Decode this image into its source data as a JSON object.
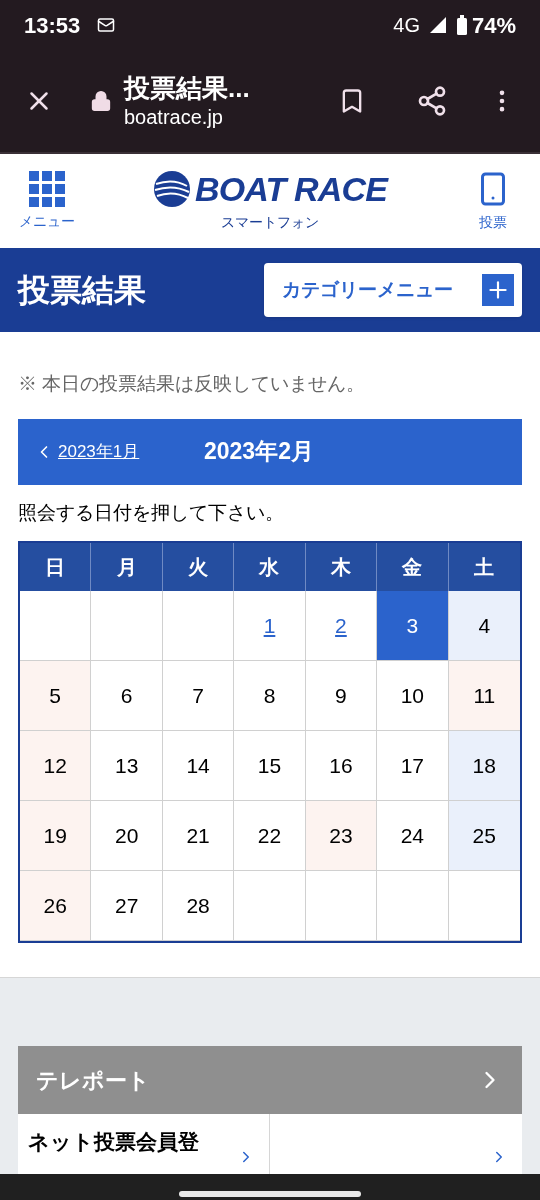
{
  "status_bar": {
    "time": "13:53",
    "network": "4G",
    "battery": "74%"
  },
  "browser": {
    "title": "投票結果...",
    "url": "boatrace.jp"
  },
  "site_header": {
    "menu_label": "メニュー",
    "logo_text": "BOAT RACE",
    "logo_sub": "スマートフォン",
    "vote_label": "投票"
  },
  "page_title": {
    "title": "投票結果",
    "category_button": "カテゴリーメニュー"
  },
  "notice": "※ 本日の投票結果は反映していません。",
  "month_nav": {
    "prev": "2023年1月",
    "current": "2023年2月"
  },
  "instruction": "照会する日付を押して下さい。",
  "calendar": {
    "weekdays": [
      "日",
      "月",
      "火",
      "水",
      "木",
      "金",
      "土"
    ],
    "weeks": [
      [
        {
          "kind": "blank"
        },
        {
          "kind": "blank"
        },
        {
          "kind": "blank"
        },
        {
          "day": "1",
          "kind": "link",
          "color": "#ffffff",
          "selected": false
        },
        {
          "day": "2",
          "kind": "link",
          "color": "#ffffff",
          "selected": false
        },
        {
          "day": "3",
          "kind": "plain",
          "color": "#2b63cc",
          "selected": true
        },
        {
          "day": "4",
          "kind": "plain",
          "color": "#eaf0fb",
          "selected": false
        }
      ],
      [
        {
          "day": "5",
          "kind": "plain",
          "color": "#fdf3f0",
          "selected": false
        },
        {
          "day": "6",
          "kind": "plain",
          "color": "#ffffff",
          "selected": false
        },
        {
          "day": "7",
          "kind": "plain",
          "color": "#ffffff",
          "selected": false
        },
        {
          "day": "8",
          "kind": "plain",
          "color": "#ffffff",
          "selected": false
        },
        {
          "day": "9",
          "kind": "plain",
          "color": "#ffffff",
          "selected": false
        },
        {
          "day": "10",
          "kind": "plain",
          "color": "#ffffff",
          "selected": false
        },
        {
          "day": "11",
          "kind": "plain",
          "color": "#fdf3f0",
          "selected": false
        }
      ],
      [
        {
          "day": "12",
          "kind": "plain",
          "color": "#fdf3f0",
          "selected": false
        },
        {
          "day": "13",
          "kind": "plain",
          "color": "#ffffff",
          "selected": false
        },
        {
          "day": "14",
          "kind": "plain",
          "color": "#ffffff",
          "selected": false
        },
        {
          "day": "15",
          "kind": "plain",
          "color": "#ffffff",
          "selected": false
        },
        {
          "day": "16",
          "kind": "plain",
          "color": "#ffffff",
          "selected": false
        },
        {
          "day": "17",
          "kind": "plain",
          "color": "#ffffff",
          "selected": false
        },
        {
          "day": "18",
          "kind": "plain",
          "color": "#eaf0fb",
          "selected": false
        }
      ],
      [
        {
          "day": "19",
          "kind": "plain",
          "color": "#fdf3f0",
          "selected": false
        },
        {
          "day": "20",
          "kind": "plain",
          "color": "#ffffff",
          "selected": false
        },
        {
          "day": "21",
          "kind": "plain",
          "color": "#ffffff",
          "selected": false
        },
        {
          "day": "22",
          "kind": "plain",
          "color": "#ffffff",
          "selected": false
        },
        {
          "day": "23",
          "kind": "plain",
          "color": "#fdf3f0",
          "selected": false
        },
        {
          "day": "24",
          "kind": "plain",
          "color": "#ffffff",
          "selected": false
        },
        {
          "day": "25",
          "kind": "plain",
          "color": "#eaf0fb",
          "selected": false
        }
      ],
      [
        {
          "day": "26",
          "kind": "plain",
          "color": "#fdf3f0",
          "selected": false
        },
        {
          "day": "27",
          "kind": "plain",
          "color": "#ffffff",
          "selected": false
        },
        {
          "day": "28",
          "kind": "plain",
          "color": "#ffffff",
          "selected": false
        },
        {
          "kind": "blank"
        },
        {
          "kind": "blank"
        },
        {
          "kind": "blank"
        },
        {
          "kind": "blank"
        }
      ]
    ]
  },
  "teleport": {
    "title": "テレポート",
    "items": [
      "ネット投票会員登"
    ]
  }
}
